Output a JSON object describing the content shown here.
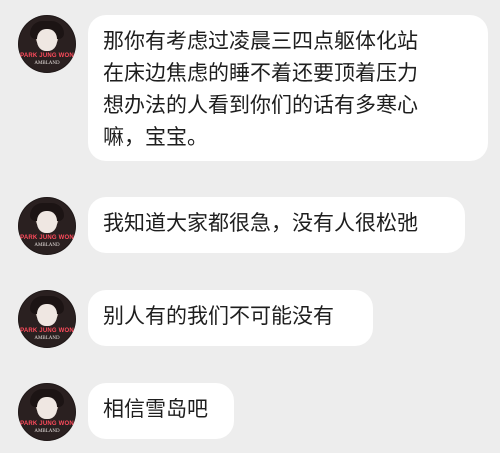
{
  "messages": [
    {
      "avatar": {
        "brand_text": "PARK JUNG WON",
        "sig_text": "AMBLAND"
      },
      "text": "那你有考虑过凌晨三四点躯体化站\n在床边焦虑的睡不着还要顶着压力\n想办法的人看到你们的话有多寒心\n嘛，宝宝。"
    },
    {
      "avatar": {
        "brand_text": "PARK JUNG WON",
        "sig_text": "AMBLAND"
      },
      "text": "我知道大家都很急，没有人很松弛"
    },
    {
      "avatar": {
        "brand_text": "PARK JUNG WON",
        "sig_text": "AMBLAND"
      },
      "text": "别人有的我们不可能没有"
    },
    {
      "avatar": {
        "brand_text": "PARK JUNG WON",
        "sig_text": "AMBLAND"
      },
      "text": "相信雪岛吧"
    }
  ],
  "colors": {
    "background": "#ededed",
    "bubble": "#ffffff",
    "text": "#1e1e1e",
    "avatar_brand": "#ff4b5c"
  },
  "icons": [
    "avatar-portrait"
  ]
}
